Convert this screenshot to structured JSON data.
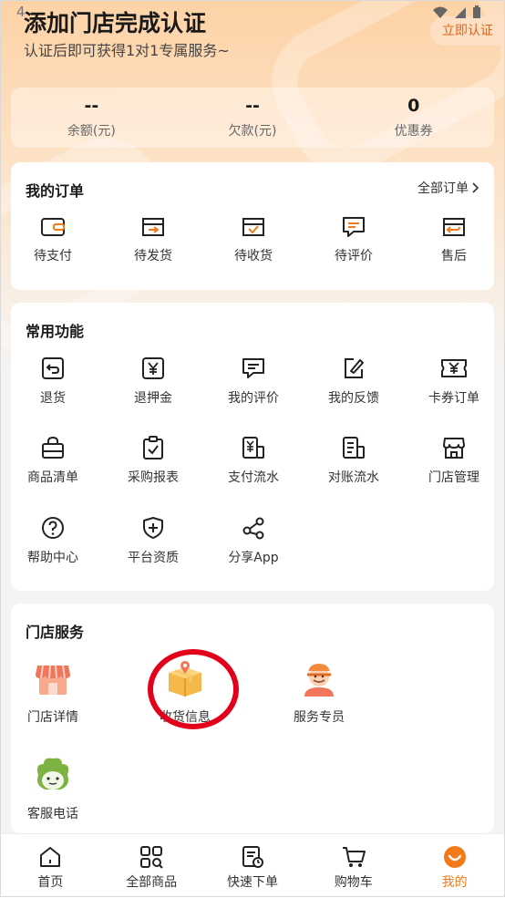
{
  "status_bar": {
    "time": "4"
  },
  "header": {
    "title": "添加门店完成认证",
    "subtitle": "认证后即可获得1对1专属服务~",
    "certify_button": "立即认证"
  },
  "stats": [
    {
      "value": "--",
      "label": "余额(元)"
    },
    {
      "value": "--",
      "label": "欠款(元)"
    },
    {
      "value": "0",
      "label": "优惠券"
    }
  ],
  "orders": {
    "title": "我的订单",
    "all_link": "全部订单",
    "items": [
      {
        "label": "待支付",
        "icon": "wallet-icon"
      },
      {
        "label": "待发货",
        "icon": "box-arrow-icon"
      },
      {
        "label": "待收货",
        "icon": "box-check-icon"
      },
      {
        "label": "待评价",
        "icon": "comment-icon"
      },
      {
        "label": "售后",
        "icon": "return-box-icon"
      }
    ]
  },
  "functions": {
    "title": "常用功能",
    "items": [
      {
        "label": "退货",
        "icon": "return-icon"
      },
      {
        "label": "退押金",
        "icon": "yen-icon"
      },
      {
        "label": "我的评价",
        "icon": "comment-icon"
      },
      {
        "label": "我的反馈",
        "icon": "edit-icon"
      },
      {
        "label": "卡券订单",
        "icon": "coupon-icon"
      },
      {
        "label": "商品清单",
        "icon": "basket-icon"
      },
      {
        "label": "采购报表",
        "icon": "clipboard-icon"
      },
      {
        "label": "支付流水",
        "icon": "payment-flow-icon"
      },
      {
        "label": "对账流水",
        "icon": "statement-icon"
      },
      {
        "label": "门店管理",
        "icon": "store-icon"
      },
      {
        "label": "帮助中心",
        "icon": "help-icon"
      },
      {
        "label": "平台资质",
        "icon": "shield-plus-icon"
      },
      {
        "label": "分享App",
        "icon": "share-icon"
      }
    ]
  },
  "store_services": {
    "title": "门店服务",
    "items": [
      {
        "label": "门店详情",
        "icon": "storefront-icon"
      },
      {
        "label": "收货信息",
        "icon": "delivery-box-icon"
      },
      {
        "label": "服务专员",
        "icon": "courier-icon"
      },
      {
        "label": "客服电话",
        "icon": "mascot-icon"
      }
    ]
  },
  "tabbar": {
    "items": [
      {
        "label": "首页",
        "icon": "home-icon"
      },
      {
        "label": "全部商品",
        "icon": "grid-icon"
      },
      {
        "label": "快速下单",
        "icon": "quick-order-icon"
      },
      {
        "label": "购物车",
        "icon": "cart-icon"
      },
      {
        "label": "我的",
        "icon": "profile-icon"
      }
    ],
    "active_index": 4
  },
  "colors": {
    "accent": "#f27a1a",
    "annotation": "#e2001a"
  }
}
